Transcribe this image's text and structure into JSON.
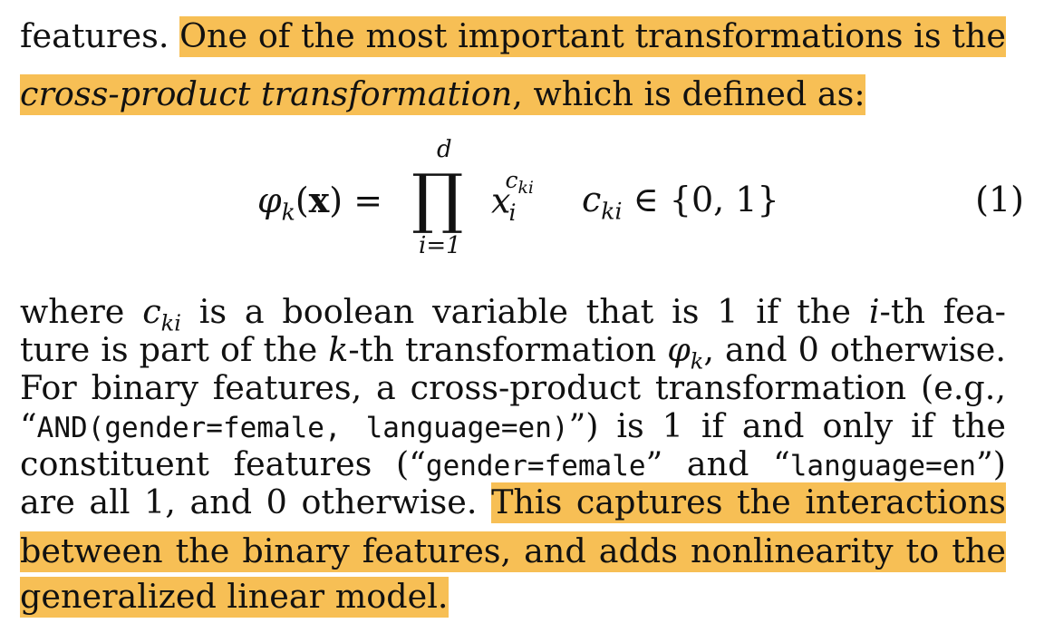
{
  "lines": {
    "l1_plain": "features. ",
    "l1_hl": "One of the most important transformations is the",
    "l2_hl_italic": "cross-product transformation",
    "l2_hl_rest": ", which is defined as:",
    "l3_a": "where ",
    "l3_var": "c",
    "l3_var_sub": "ki",
    "l3_b": " is a boolean variable that is 1 if the ",
    "l3_i": "i",
    "l3_c": "-th fea-",
    "l4_a": "ture is part of the ",
    "l4_k": "k",
    "l4_b": "-th transformation ",
    "l4_phi": "φ",
    "l4_phi_sub": "k",
    "l4_c": ", and 0 otherwise.",
    "l5": "For binary features, a cross-product transformation (e.g.,",
    "l6_q1": "“",
    "l6_mono": "AND(gender=female, language=en)",
    "l6_rest": "”) is 1 if and only if the",
    "l7_a": "constituent features (“",
    "l7_mono1": "gender=female",
    "l7_b": "” and “",
    "l7_mono2": "language=en",
    "l7_c": "”)",
    "l8_plain": "are all 1, and 0 otherwise. ",
    "l8_hl": "This captures the interactions",
    "l9_hl": "between the binary features, and adds nonlinearity to the",
    "l10_hl": "generalized linear model."
  },
  "equation": {
    "lhs_phi": "φ",
    "lhs_sub": "k",
    "lhs_paren_open": "(",
    "lhs_x": "x",
    "lhs_paren_close": ") =",
    "prod_symbol": "∏",
    "prod_upper": "d",
    "prod_lower": "i=1",
    "rhs_x": "x",
    "rhs_sub": "i",
    "rhs_sup_c": "c",
    "rhs_sup_sub": "ki",
    "cond_c": "c",
    "cond_sub": "ki",
    "cond_rest": " ∈ {0, 1}",
    "number": "(1)"
  },
  "colors": {
    "highlight": "#f7bf55",
    "text": "#111111"
  }
}
